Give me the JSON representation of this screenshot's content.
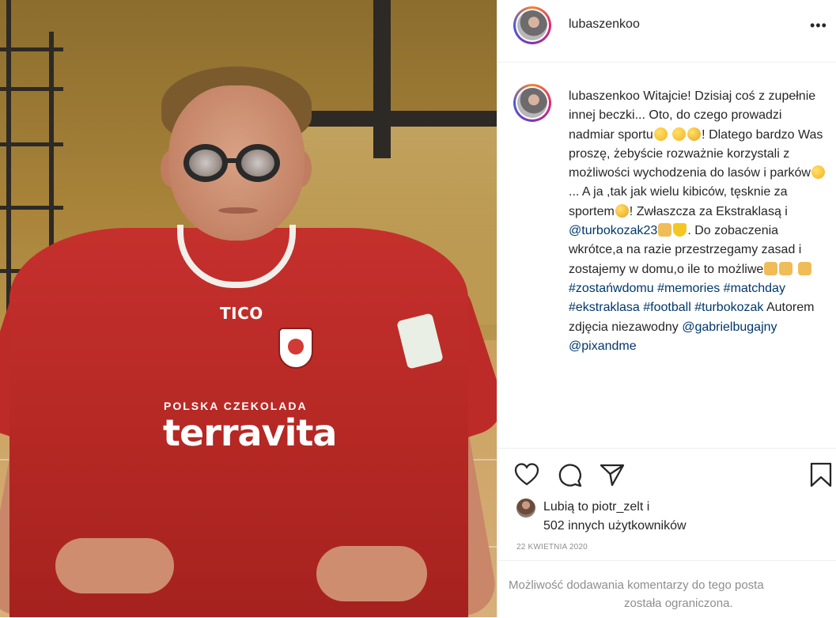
{
  "post": {
    "username": "lubaszenkoo",
    "more_icon": "more-icon",
    "caption": {
      "username": "lubaszenkoo",
      "text_1": " Witajcie! Dzisiaj coś z zupełnie innej beczki... Oto, do czego prowadzi nadmiar sportu",
      "text_2": "! Dlatego bardzo Was proszę, żebyście rozważnie korzystali z możliwości wychodzenia do lasów i parków",
      "text_3": "... A ja ,tak jak wielu kibiców, tęsknie za sportem",
      "text_4": "! Zwłaszcza za Ekstraklasą i ",
      "mention_1": "@turbokozak23",
      "text_5": ". Do zobaczenia wkrótce,a na razie przestrzegamy zasad i zostajemy w domu,o ile to możliwe",
      "hashtag_1": "#zostańwdomu",
      "hashtag_2": "#memories",
      "hashtag_3": "#matchday",
      "hashtag_4": "#ekstraklasa",
      "hashtag_5": "#football",
      "hashtag_6": "#turbokozak",
      "text_6": " Autorem zdjęcia niezawodny ",
      "mention_2": "@gabrielbugajny",
      "mention_3": "@pixandme"
    },
    "actions": {
      "like": "heart-icon",
      "comment": "comment-icon",
      "share": "paper-plane-icon",
      "save": "bookmark-icon"
    },
    "likes": {
      "line1": "Lubią to piotr_zelt i",
      "line2": "502 innych użytkowników"
    },
    "date": "22 KWIETNIA 2020",
    "comments_disabled": {
      "line1": "Możliwość dodawania komentarzy do tego posta",
      "line2": "została ograniczona."
    }
  },
  "photo": {
    "shirt_brand": "TICO",
    "sponsor_small": "POLSKA CZEKOLADA",
    "sponsor_big": "terravita"
  },
  "colors": {
    "link": "#00376b",
    "text": "#262626",
    "muted": "#8e8e8e",
    "shirt": "#c5302d"
  }
}
